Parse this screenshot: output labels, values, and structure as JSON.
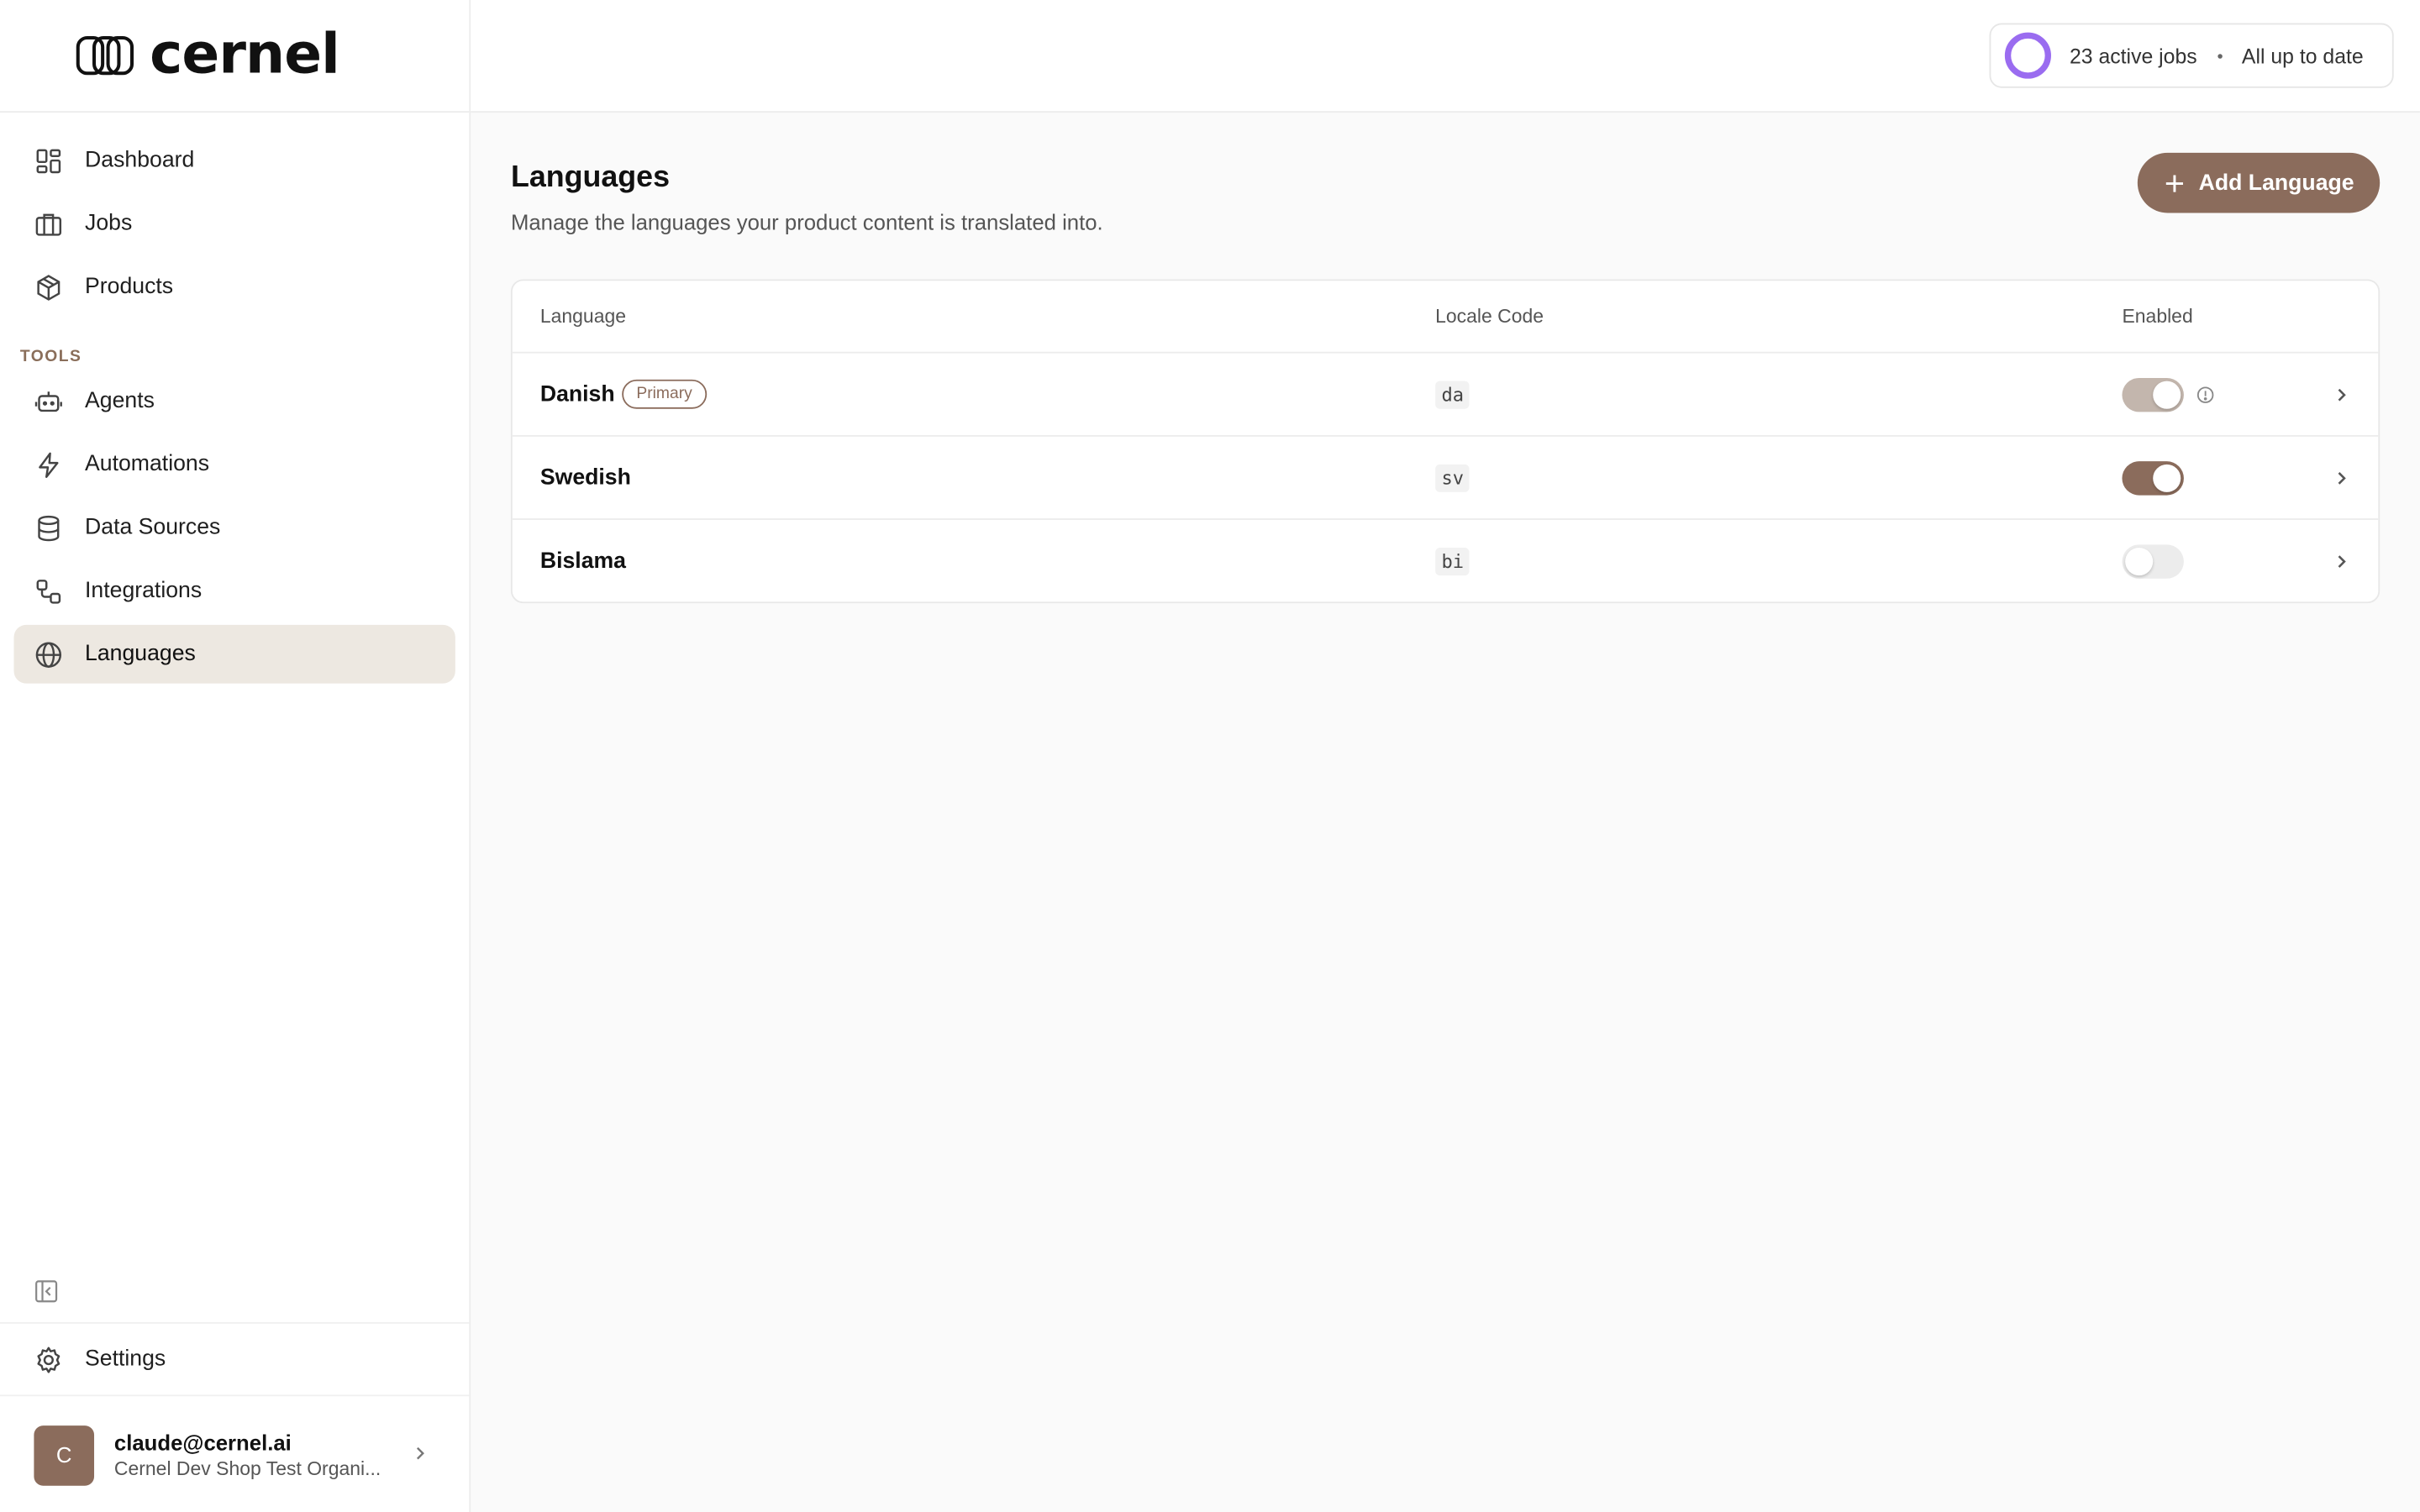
{
  "brand": {
    "name": "cernel"
  },
  "nav": {
    "primary": [
      {
        "label": "Dashboard",
        "icon": "dashboard-icon"
      },
      {
        "label": "Jobs",
        "icon": "briefcase-icon"
      },
      {
        "label": "Products",
        "icon": "package-icon"
      }
    ],
    "tools_title": "TOOLS",
    "tools": [
      {
        "label": "Agents",
        "icon": "robot-icon"
      },
      {
        "label": "Automations",
        "icon": "lightning-icon"
      },
      {
        "label": "Data Sources",
        "icon": "database-icon"
      },
      {
        "label": "Integrations",
        "icon": "integrations-icon"
      },
      {
        "label": "Languages",
        "icon": "globe-icon",
        "active": true
      }
    ],
    "settings_label": "Settings"
  },
  "user": {
    "initial": "C",
    "email": "claude@cernel.ai",
    "org": "Cernel Dev Shop Test Organi..."
  },
  "topbar": {
    "jobs_text": "23 active jobs",
    "status_text": "All up to date"
  },
  "page": {
    "title": "Languages",
    "description": "Manage the languages your product content is translated into.",
    "add_button_label": "Add Language"
  },
  "table": {
    "headers": {
      "language": "Language",
      "locale": "Locale Code",
      "enabled": "Enabled"
    },
    "rows": [
      {
        "name": "Danish",
        "badge": "Primary",
        "code": "da",
        "enabled": true,
        "locked": true
      },
      {
        "name": "Swedish",
        "badge": "",
        "code": "sv",
        "enabled": true,
        "locked": false
      },
      {
        "name": "Bislama",
        "badge": "",
        "code": "bi",
        "enabled": false,
        "locked": false
      }
    ]
  },
  "colors": {
    "accent": "#8b6c5c",
    "active_nav_bg": "#ede8e1",
    "progress_ring": "#9a6cf0"
  }
}
